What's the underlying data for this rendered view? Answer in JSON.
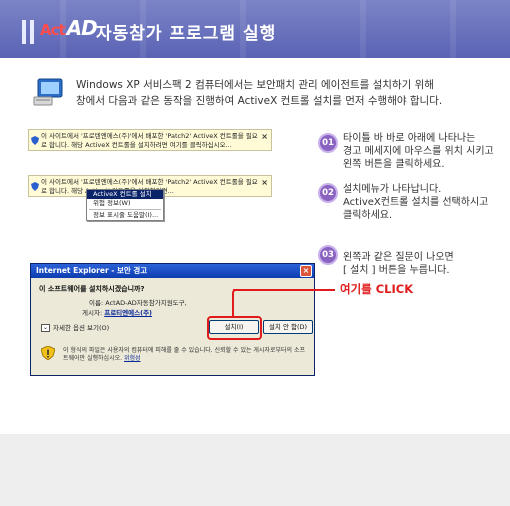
{
  "header": {
    "logo_prefix": "Act",
    "logo_text": "AD",
    "title": "자동참가 프로그램 실행"
  },
  "intro": {
    "line1": "Windows XP 서비스팩 2 컴퓨터에서는 보안패치 관리 에이전트를 설치하기 위해",
    "line2": "창에서 다음과 같은 동작을 진행하여 ActiveX 컨트롤 설치를 먼저 수행해야 합니다."
  },
  "infobar1": {
    "text": "이 사이트에서 '프로텐엔에스(주)'에서 배포한 'Patch2' ActiveX 컨트롤을 필요로 합니다. 해당 ActiveX 컨트롤을 설치하려면 여기를 클릭하십시오..."
  },
  "infobar2": {
    "text": "이 사이트에서 '프로텐엔에스(주)'에서 배포한 'Patch2' ActiveX 컨트롤을 필요로 합니다. 해당 ActiveX 컨트롤을 설치하려면..."
  },
  "context_menu": {
    "items": [
      "ActiveX 컨트롤 설치(C)...",
      "위험 정보(W)",
      "정보 표시줄 도움말(I)..."
    ]
  },
  "steps": [
    {
      "num": "01",
      "line1": "타이틀 바 바로 아래에 나타나는",
      "line2": "경고 메세지에 마우스를 위치 시키고",
      "line3": "왼쪽 버튼을 클릭하세요."
    },
    {
      "num": "02",
      "line1": "설치메뉴가 나타납니다.",
      "line2": "ActiveX컨트롤 설치를 선택하시고",
      "line3": "클릭하세요."
    },
    {
      "num": "03",
      "line1": "왼쪽과 같은 질문이 나오면",
      "line2": "[ 설치 ] 버튼을 누릅니다."
    }
  ],
  "dialog": {
    "title": "Internet Explorer - 보안 경고",
    "question": "이 소프트웨어를 설치하시겠습니까?",
    "name_label": "이름:",
    "name_value": "ActAD-AD자동참가지원도구,",
    "publisher_label": "게시자:",
    "publisher_value": "프로티엔에스(주)",
    "more_options": "자세한 옵션 보기(O)",
    "install_button": "설치(I)",
    "cancel_button": "설치 안 함(D)",
    "warning_text": "이 형식의 파일은 사용자의 컴퓨터에 피해를 줄 수 있습니다. 신뢰할 수 있는 게시자로부터의 소프트웨어만 실행하십시오.",
    "warning_link": "위험성"
  },
  "click_label": "여기를 CLICK",
  "colors": {
    "header": "#6a72c0",
    "step": "#8a63c0",
    "highlight": "#e01b1b",
    "infobar": "#fffbd7"
  }
}
